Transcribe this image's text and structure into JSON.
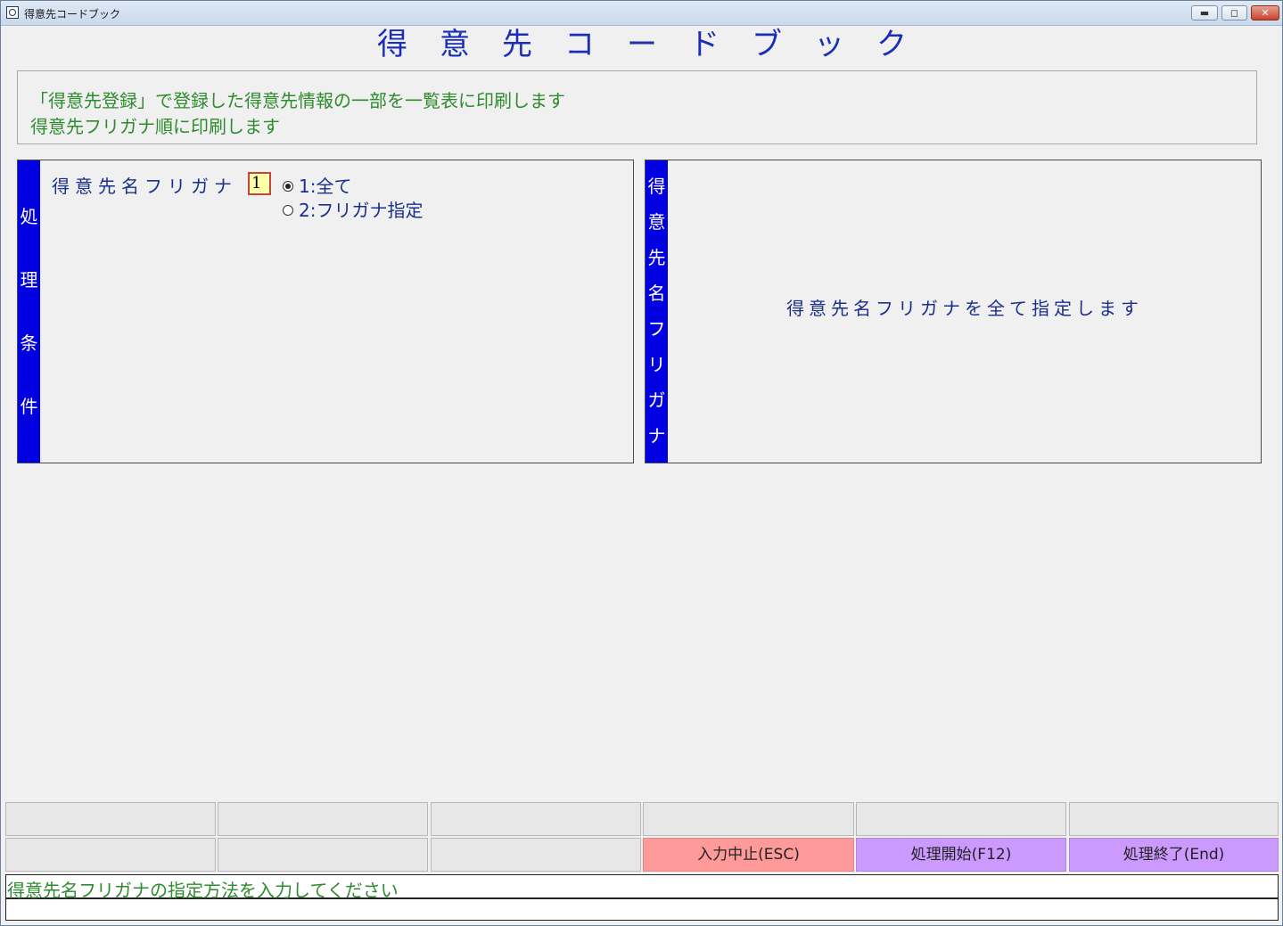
{
  "window": {
    "title": "得意先コードブック",
    "min_glyph": "▬",
    "max_glyph": "◻",
    "close_glyph": "✕"
  },
  "header": {
    "title": "得意先コードブック"
  },
  "description": {
    "line1": "「得意先登録」で登録した得意先情報の一部を一覧表に印刷します",
    "line2": "得意先フリガナ順に印刷します"
  },
  "conditions_panel": {
    "side_label": [
      "処",
      "理",
      "条",
      "件"
    ],
    "field_label": "得意先名フリガナ",
    "input_value": "1",
    "options": [
      {
        "label": "1:全て",
        "selected": true
      },
      {
        "label": "2:フリガナ指定",
        "selected": false
      }
    ]
  },
  "help_panel": {
    "side_label": [
      "得",
      "意",
      "先",
      "名",
      "フ",
      "リ",
      "ガ",
      "ナ"
    ],
    "text": "得意先名フリガナを全て指定します"
  },
  "function_keys": {
    "row1": [
      "",
      "",
      "",
      "",
      "",
      ""
    ],
    "row2": [
      "",
      "",
      "",
      "入力中止(ESC)",
      "処理開始(F12)",
      "処理終了(End)"
    ]
  },
  "status": {
    "message": "得意先名フリガナの指定方法を入力してください",
    "second_line": ""
  },
  "colors": {
    "title_blue": "#1a2fb5",
    "side_bar_blue": "#0000e0",
    "description_green": "#2e8b2e",
    "esc_button": "#ff9a9a",
    "action_buttons": "#cc99ff",
    "input_bg": "#ffffa8"
  }
}
